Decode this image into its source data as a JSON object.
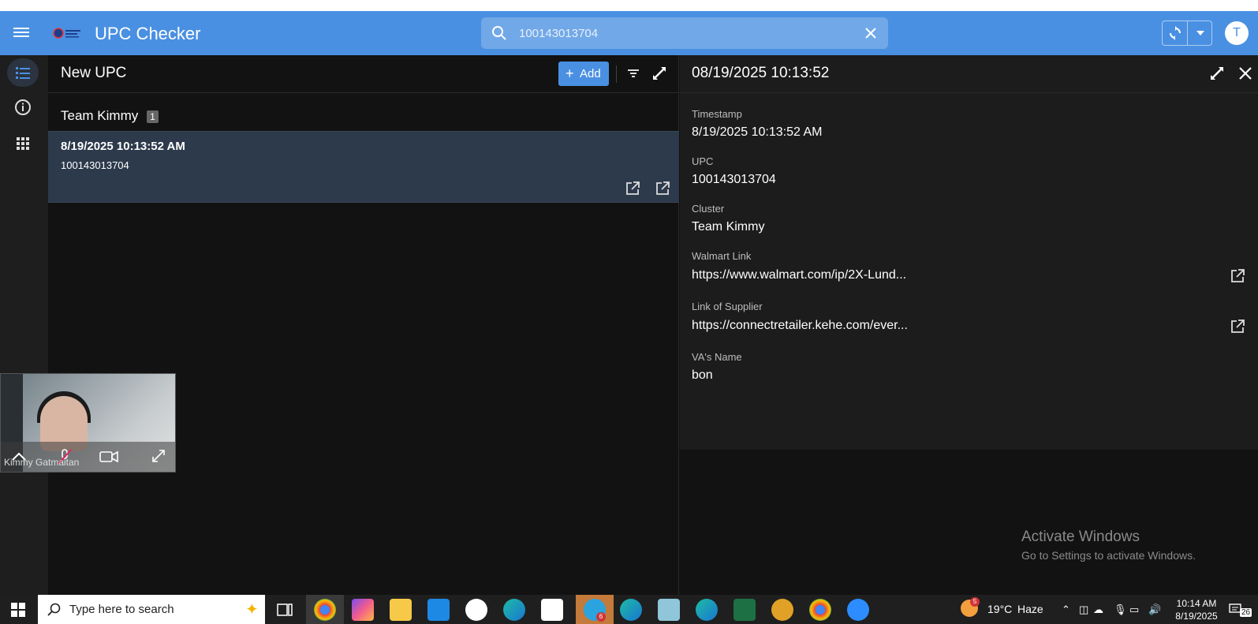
{
  "app": {
    "title": "UPC Checker",
    "avatar_initial": "T"
  },
  "search": {
    "value": "100143013704",
    "placeholder": "Search"
  },
  "list": {
    "title": "New UPC",
    "add_label": "Add",
    "group": {
      "name": "Team Kimmy",
      "count": "1"
    },
    "rows": [
      {
        "timestamp": "8/19/2025 10:13:52 AM",
        "upc": "100143013704"
      }
    ]
  },
  "detail": {
    "title": "08/19/2025 10:13:52",
    "fields": [
      {
        "label": "Timestamp",
        "value": "8/19/2025 10:13:52 AM"
      },
      {
        "label": "UPC",
        "value": "100143013704"
      },
      {
        "label": "Cluster",
        "value": "Team Kimmy"
      },
      {
        "label": "Walmart Link",
        "value": "https://www.walmart.com/ip/2X-Lund..."
      },
      {
        "label": "Link of Supplier",
        "value": "https://connectretailer.kehe.com/ever..."
      },
      {
        "label": "VA's Name",
        "value": "bon"
      }
    ]
  },
  "watermark": {
    "line1": "Activate Windows",
    "line2": "Go to Settings to activate Windows."
  },
  "video": {
    "participant": "Kimmy Gatmaitan"
  },
  "taskbar": {
    "search_placeholder": "Type here to search",
    "temperature": "19°C",
    "condition": "Haze",
    "weather_badge": "5",
    "telegram_badge": "6",
    "time": "10:14 AM",
    "date": "8/19/2025",
    "notifications": "26"
  },
  "colors": {
    "appbar": "#4a90e2",
    "accent": "#4a90e2",
    "selected_row": "#2c3a4b"
  }
}
